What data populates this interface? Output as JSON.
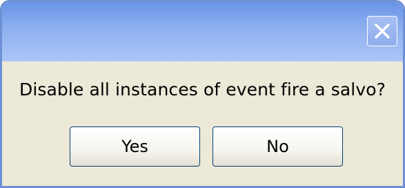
{
  "dialog": {
    "title": "",
    "message": "Disable all instances of event fire a salvo?",
    "close_icon": "close-icon"
  },
  "buttons": {
    "yes_label": "Yes",
    "no_label": "No"
  },
  "colors": {
    "titlebar": "#8eb0f0",
    "body": "#ece9d8",
    "button_border": "#003c74"
  }
}
